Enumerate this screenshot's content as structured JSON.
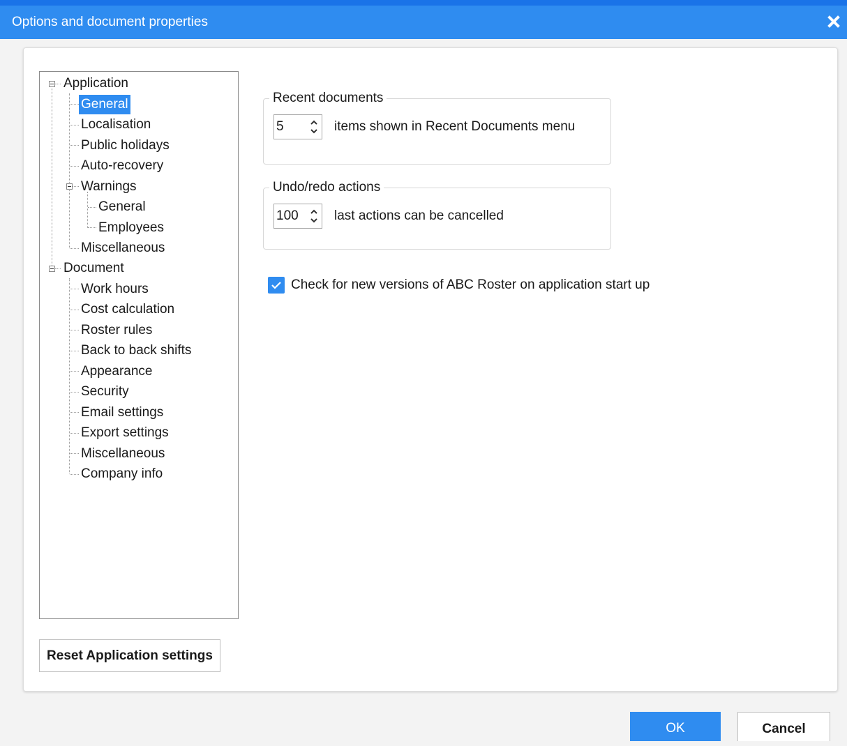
{
  "window": {
    "title": "Options and document properties",
    "close_icon": "close-icon"
  },
  "tree": {
    "application": {
      "label": "Application",
      "children": [
        "General",
        "Localisation",
        "Public holidays",
        "Auto-recovery"
      ],
      "warnings": {
        "label": "Warnings",
        "children": [
          "General",
          "Employees"
        ]
      },
      "misc": "Miscellaneous"
    },
    "document": {
      "label": "Document",
      "children": [
        "Work hours",
        "Cost calculation",
        "Roster rules",
        "Back to back shifts",
        "Appearance",
        "Security",
        "Email settings",
        "Export settings",
        "Miscellaneous",
        "Company info"
      ]
    },
    "selected": "Application / General"
  },
  "buttons": {
    "reset": "Reset Application settings",
    "ok": "OK",
    "cancel": "Cancel"
  },
  "recent": {
    "label": "Recent documents",
    "value": "5",
    "text": "items shown in Recent Documents menu"
  },
  "undo": {
    "label": "Undo/redo actions",
    "value": "100",
    "text": "last actions can be cancelled"
  },
  "check_updates": {
    "label": "Check for new versions of ABC Roster on application start up",
    "checked": true
  },
  "colors": {
    "accent": "#2f8cf0",
    "title_strip": "#1a73e8"
  }
}
